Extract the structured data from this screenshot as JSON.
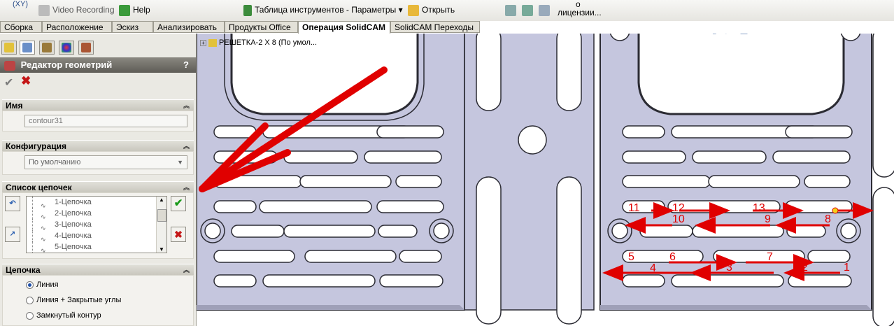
{
  "toolbar": {
    "xy_label": "(XY)",
    "video_recording": "Video Recording",
    "help": "Help",
    "tools_table": "Таблица инструментов - Параметры",
    "open": "Открыть",
    "license_line1": "о",
    "license_line2": "лицензии..."
  },
  "tabs": [
    "Сборка",
    "Расположение",
    "Эскиз",
    "Анализировать",
    "Продукты Office",
    "Операция  SolidCAM",
    "SolidCAM Переходы"
  ],
  "panel": {
    "title": "Редактор геометрий",
    "help": "?",
    "name_section": {
      "header": "Имя",
      "value": "contour31"
    },
    "config_section": {
      "header": "Конфигурация",
      "value": "По умолчанию"
    },
    "chains_section": {
      "header": "Список цепочек",
      "items": [
        "1-Цепочка",
        "2-Цепочка",
        "3-Цепочка",
        "4-Цепочка",
        "5-Цепочка"
      ]
    },
    "chain_section": {
      "header": "Цепочка",
      "options": [
        "Линия",
        "Линия + Закрытые углы",
        "Замкнутый контур"
      ],
      "selected": 0
    }
  },
  "viewport": {
    "tree_label": "РЕШЕТКА-2 X 8  (По умол...",
    "chain_labels": [
      "1",
      "2",
      "3",
      "4",
      "5",
      "6",
      "7",
      "8",
      "9",
      "10",
      "11",
      "12",
      "13"
    ]
  },
  "colors": {
    "accent": "#e00000",
    "part": "#c5c6de",
    "panel": "#eae9e3"
  }
}
